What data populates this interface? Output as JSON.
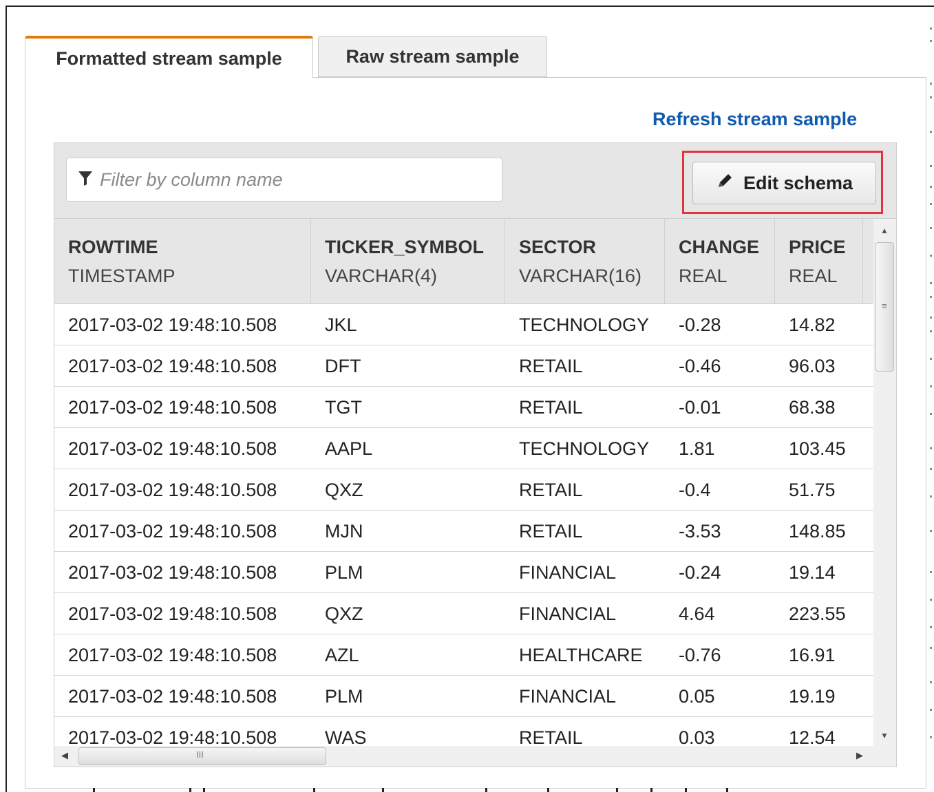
{
  "tabs": [
    {
      "label": "Formatted stream sample",
      "active": true
    },
    {
      "label": "Raw stream sample",
      "active": false
    }
  ],
  "refresh_link": "Refresh stream sample",
  "filter": {
    "placeholder": "Filter by column name",
    "value": ""
  },
  "edit_schema_label": "Edit schema",
  "columns": [
    {
      "name": "ROWTIME",
      "type": "TIMESTAMP"
    },
    {
      "name": "TICKER_SYMBOL",
      "type": "VARCHAR(4)"
    },
    {
      "name": "SECTOR",
      "type": "VARCHAR(16)"
    },
    {
      "name": "CHANGE",
      "type": "REAL"
    },
    {
      "name": "PRICE",
      "type": "REAL"
    }
  ],
  "rows": [
    [
      "2017-03-02 19:48:10.508",
      "JKL",
      "TECHNOLOGY",
      "-0.28",
      "14.82"
    ],
    [
      "2017-03-02 19:48:10.508",
      "DFT",
      "RETAIL",
      "-0.46",
      "96.03"
    ],
    [
      "2017-03-02 19:48:10.508",
      "TGT",
      "RETAIL",
      "-0.01",
      "68.38"
    ],
    [
      "2017-03-02 19:48:10.508",
      "AAPL",
      "TECHNOLOGY",
      "1.81",
      "103.45"
    ],
    [
      "2017-03-02 19:48:10.508",
      "QXZ",
      "RETAIL",
      "-0.4",
      "51.75"
    ],
    [
      "2017-03-02 19:48:10.508",
      "MJN",
      "RETAIL",
      "-3.53",
      "148.85"
    ],
    [
      "2017-03-02 19:48:10.508",
      "PLM",
      "FINANCIAL",
      "-0.24",
      "19.14"
    ],
    [
      "2017-03-02 19:48:10.508",
      "QXZ",
      "FINANCIAL",
      "4.64",
      "223.55"
    ],
    [
      "2017-03-02 19:48:10.508",
      "AZL",
      "HEALTHCARE",
      "-0.76",
      "16.91"
    ],
    [
      "2017-03-02 19:48:10.508",
      "PLM",
      "FINANCIAL",
      "0.05",
      "19.19"
    ],
    [
      "2017-03-02 19:48:10.508",
      "WAS",
      "RETAIL",
      "0.03",
      "12.54"
    ]
  ],
  "colors": {
    "active_tab_accent": "#e07b00",
    "link": "#0f5bb0",
    "highlight": "#e0343e"
  },
  "icons": {
    "filter": "filter-icon",
    "edit": "pencil-icon"
  }
}
